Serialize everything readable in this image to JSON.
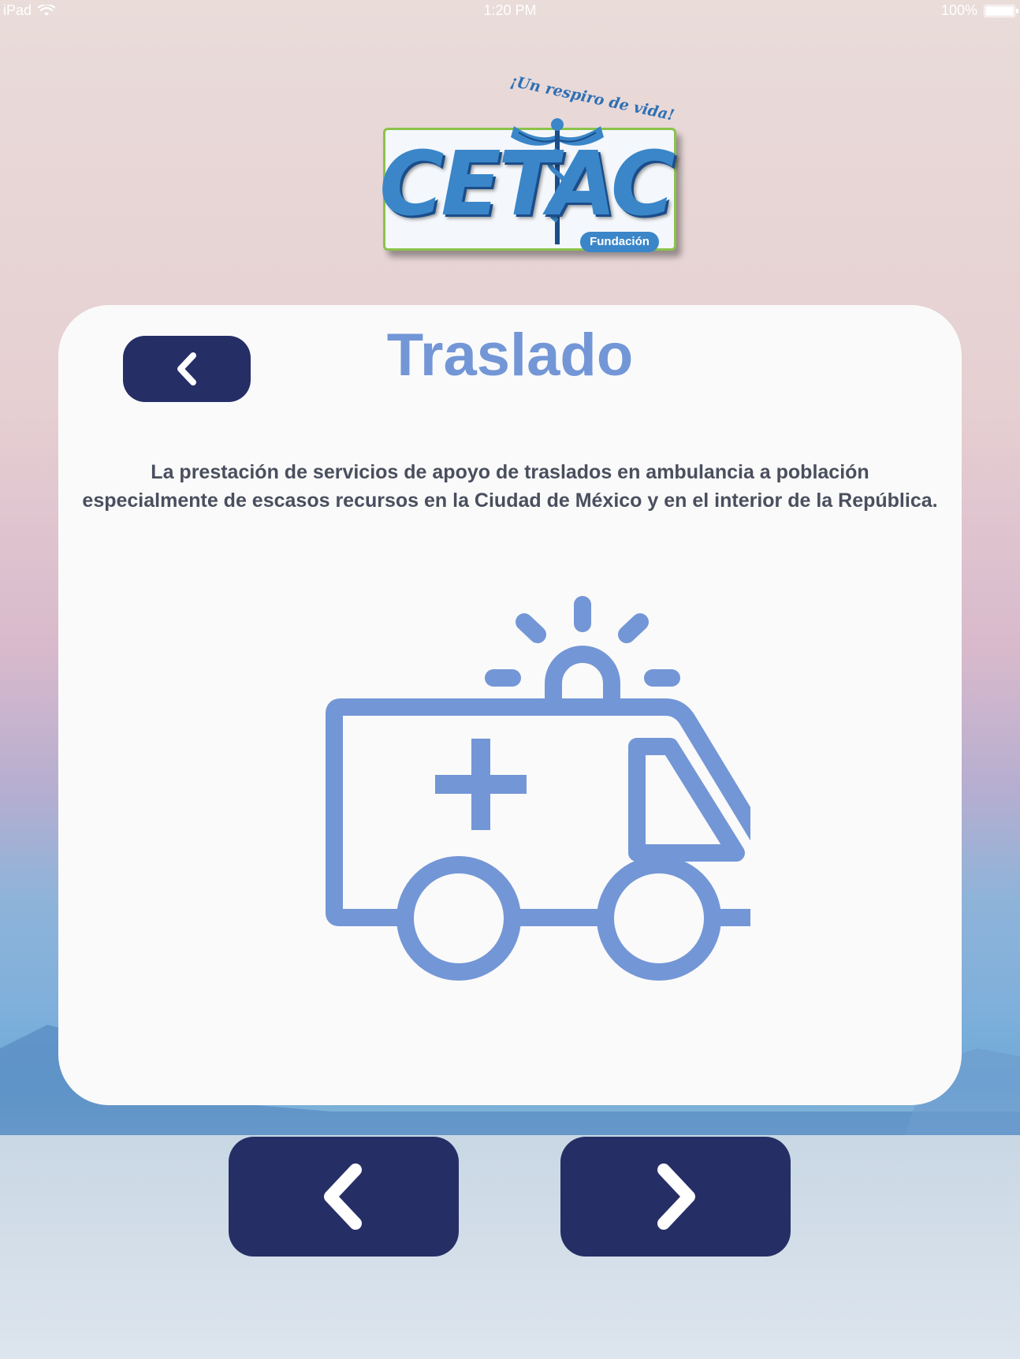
{
  "status_bar": {
    "device": "iPad",
    "time": "1:20 PM",
    "battery": "100%"
  },
  "logo": {
    "tagline": "¡Un respiro de vida!",
    "name": "CETAC",
    "badge": "Fundación"
  },
  "card": {
    "title": "Traslado",
    "description_line1": "La prestación de servicios de apoyo de traslados en ambulancia a población",
    "description_line2": "especialmente de escasos recursos en la Ciudad de México y en el interior de la República."
  },
  "colors": {
    "accent": "#7396d6",
    "button": "#262e66",
    "card": "#fafafa",
    "text": "#4a4f5e"
  },
  "icons": {
    "card_back": "chevron-left-icon",
    "illustration": "ambulance-icon",
    "nav_prev": "chevron-left-icon",
    "nav_next": "chevron-right-icon"
  }
}
